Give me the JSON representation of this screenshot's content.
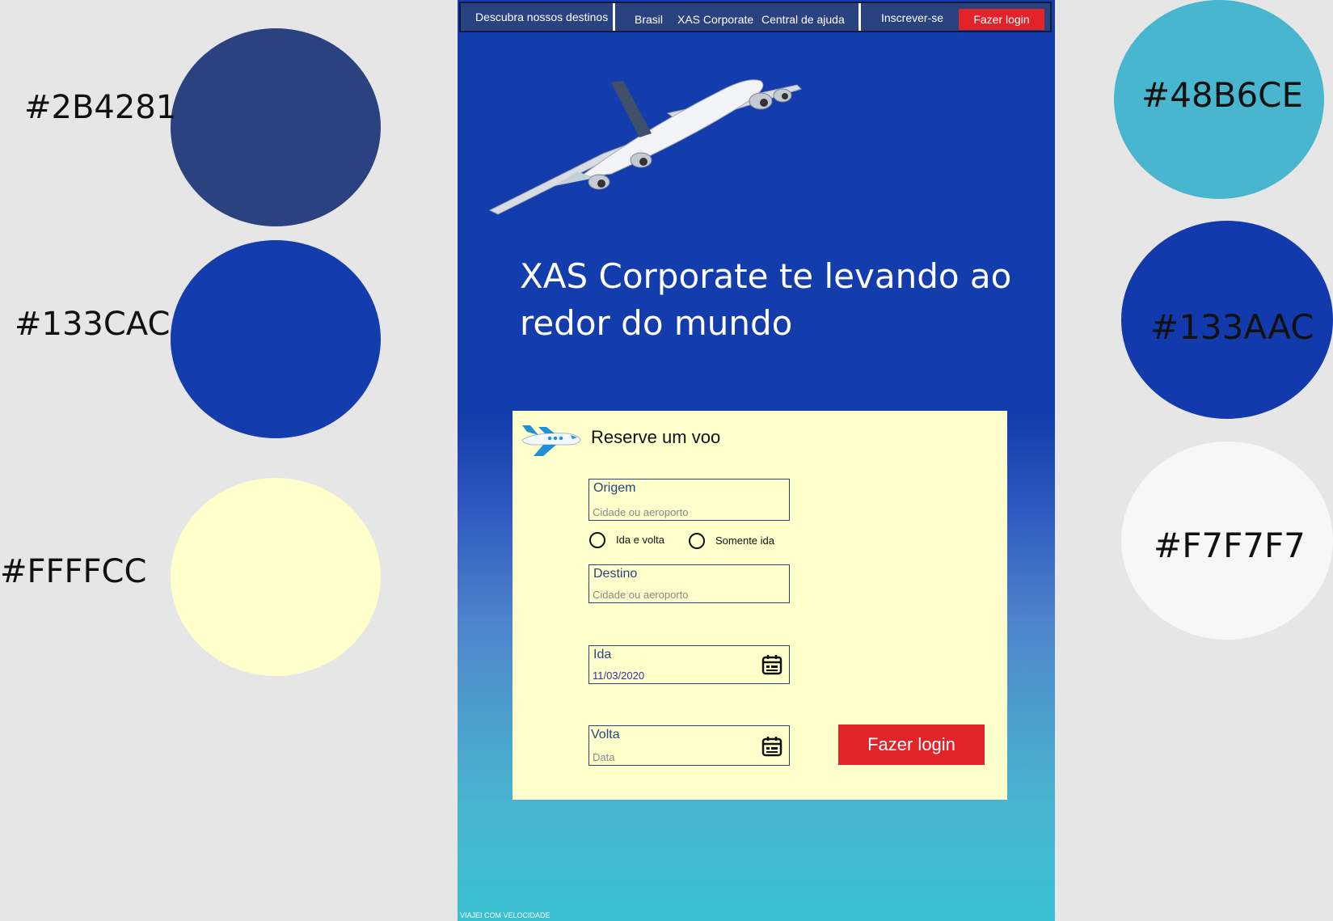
{
  "palette": {
    "left": [
      {
        "label": "#2B4281",
        "color": "#2B4281"
      },
      {
        "label": "#133CAC",
        "color": "#133CAC"
      },
      {
        "label": "#FFFFCC",
        "color": "#FFFFCC"
      }
    ],
    "right": [
      {
        "label": "#48B6CE",
        "color": "#48B6CE"
      },
      {
        "label": "#133AAC",
        "color": "#133AAC"
      },
      {
        "label": "#F7F7F7",
        "color": "#F7F7F7"
      }
    ]
  },
  "nav": {
    "discover": "Descubra nossos destinos",
    "brasil": "Brasil",
    "corporate": "XAS Corporate",
    "help": "Central de ajuda",
    "signup": "Inscrever-se",
    "login": "Fazer login"
  },
  "hero": {
    "title": "XAS Corporate te levando ao redor do mundo"
  },
  "booking": {
    "title": "Reserve um voo",
    "origin": {
      "label": "Origem",
      "placeholder": "Cidade ou aeroporto"
    },
    "trip_type": {
      "round_trip": "Ida e volta",
      "one_way": "Somente ida"
    },
    "destination": {
      "label": "Destino",
      "placeholder": "Cidade ou aeroporto"
    },
    "departure": {
      "label": "Ida",
      "value": "11/03/2020"
    },
    "return": {
      "label": "Volta",
      "placeholder": "Data"
    },
    "submit": "Fazer login"
  },
  "footer": {
    "tagline": "VIAJEI COM VELOCIDADE"
  },
  "colors": {
    "nav_bg": "#2B4281",
    "hero_bg": "#133CAC",
    "card_bg": "#FFFFCC",
    "gradient_end": "#48B6CE",
    "button_red": "#e2232a"
  }
}
